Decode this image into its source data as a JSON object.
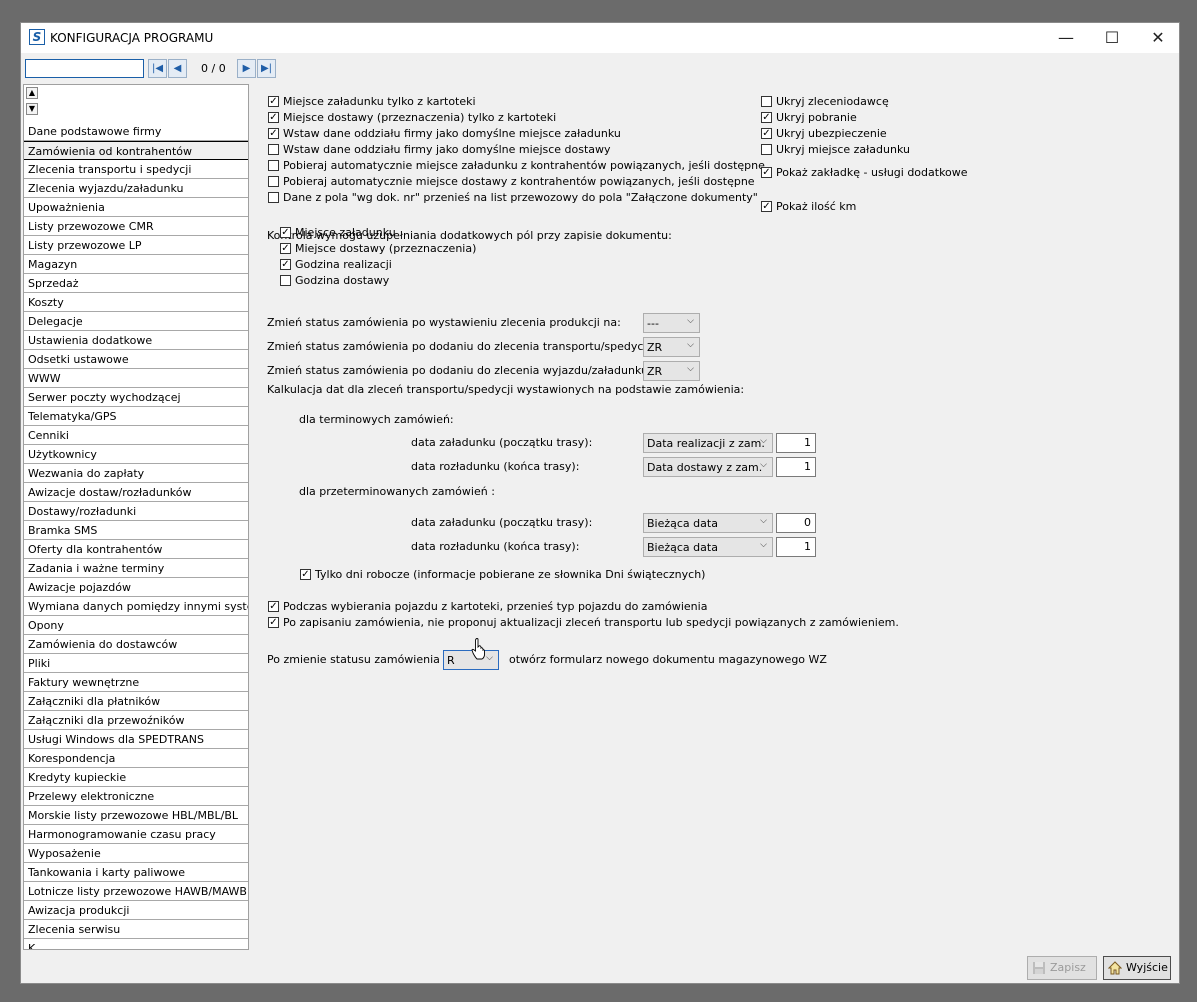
{
  "window": {
    "title": "KONFIGURACJA PROGRAMU",
    "app_icon_letter": "S",
    "minimize_glyph": "—",
    "maximize_glyph": "☐",
    "close_glyph": "✕"
  },
  "toolbar": {
    "search_value": "",
    "counter": "0 / 0",
    "first_glyph": "|◀",
    "prev_glyph": "◀",
    "next_glyph": "▶",
    "last_glyph": "▶|"
  },
  "sidebar": {
    "scroll_up_glyph": "▲",
    "scroll_down_glyph": "▼",
    "items": [
      {
        "label": "Dane podstawowe firmy"
      },
      {
        "label": "Zamówienia od kontrahentów"
      },
      {
        "label": "Zlecenia transportu i spedycji"
      },
      {
        "label": "Zlecenia wyjazdu/załadunku"
      },
      {
        "label": "Upoważnienia"
      },
      {
        "label": "Listy przewozowe CMR"
      },
      {
        "label": "Listy przewozowe LP"
      },
      {
        "label": "Magazyn"
      },
      {
        "label": "Sprzedaż"
      },
      {
        "label": "Koszty"
      },
      {
        "label": "Delegacje"
      },
      {
        "label": "Ustawienia dodatkowe"
      },
      {
        "label": "Odsetki ustawowe"
      },
      {
        "label": "WWW"
      },
      {
        "label": "Serwer poczty wychodzącej"
      },
      {
        "label": "Telematyka/GPS"
      },
      {
        "label": "Cenniki"
      },
      {
        "label": "Użytkownicy"
      },
      {
        "label": "Wezwania do zapłaty"
      },
      {
        "label": "Awizacje dostaw/rozładunków"
      },
      {
        "label": "Dostawy/rozładunki"
      },
      {
        "label": "Bramka SMS"
      },
      {
        "label": "Oferty dla kontrahentów"
      },
      {
        "label": "Zadania i ważne terminy"
      },
      {
        "label": "Awizacje pojazdów"
      },
      {
        "label": "Wymiana danych pomiędzy innymi systemami"
      },
      {
        "label": "Opony"
      },
      {
        "label": "Zamówienia do dostawców"
      },
      {
        "label": "Pliki"
      },
      {
        "label": "Faktury wewnętrzne"
      },
      {
        "label": "Załączniki dla płatników"
      },
      {
        "label": "Załączniki dla przewoźników"
      },
      {
        "label": "Usługi Windows dla SPEDTRANS"
      },
      {
        "label": "Korespondencja"
      },
      {
        "label": "Kredyty kupieckie"
      },
      {
        "label": "Przelewy elektroniczne"
      },
      {
        "label": "Morskie listy przewozowe HBL/MBL/BL"
      },
      {
        "label": "Harmonogramowanie czasu pracy"
      },
      {
        "label": "Wyposażenie"
      },
      {
        "label": "Tankowania i karty paliwowe"
      },
      {
        "label": "Lotnicze listy przewozowe HAWB/MAWB"
      },
      {
        "label": "Awizacja produkcji"
      },
      {
        "label": "Zlecenia serwisu"
      },
      {
        "label": "K"
      }
    ]
  },
  "options_left": [
    {
      "label": "Miejsce załadunku tylko z kartoteki",
      "checked": true
    },
    {
      "label": "Miejsce dostawy (przeznaczenia) tylko z kartoteki",
      "checked": true
    },
    {
      "label": "Wstaw dane oddziału firmy jako domyślne miejsce załadunku",
      "checked": true
    },
    {
      "label": "Wstaw dane oddziału firmy jako domyślne miejsce dostawy",
      "checked": false
    },
    {
      "label": "Pobieraj automatycznie miejsce załadunku z kontrahentów powiązanych, jeśli dostępne",
      "checked": false
    },
    {
      "label": "Pobieraj automatycznie miejsce dostawy  z kontrahentów powiązanych, jeśli dostępne",
      "checked": false
    },
    {
      "label": "Dane z pola \"wg dok. nr\" przenieś na list przewozowy do pola \"Załączone dokumenty\"",
      "checked": false
    }
  ],
  "options_right": [
    {
      "label": "Ukryj zleceniodawcę",
      "checked": false
    },
    {
      "label": "Ukryj pobranie",
      "checked": true
    },
    {
      "label": "Ukryj ubezpieczenie",
      "checked": true
    },
    {
      "label": "Ukryj miejsce załadunku",
      "checked": false
    },
    {
      "label": "Pokaż zakładkę - usługi dodatkowe",
      "checked": true
    },
    {
      "label": "Pokaż ilość km",
      "checked": true
    }
  ],
  "required_fields": {
    "heading": "Kontrola wymogu uzupełniania dodatkowych pól przy zapisie dokumentu:",
    "items": [
      {
        "label": "Miejsce załadunku",
        "checked": true
      },
      {
        "label": "Miejsce dostawy (przeznaczenia)",
        "checked": true
      },
      {
        "label": "Godzina realizacji",
        "checked": true
      },
      {
        "label": "Godzina dostawy",
        "checked": false
      }
    ]
  },
  "status_changes": [
    {
      "label": "Zmień status zamówienia po wystawieniu zlecenia produkcji na:",
      "value": "---"
    },
    {
      "label": "Zmień status zamówienia po dodaniu do zlecenia transportu/spedycji na:",
      "value": "ZR"
    },
    {
      "label": "Zmień status zamówienia po dodaniu do zlecenia wyjazdu/załadunku na:",
      "value": "ZR"
    }
  ],
  "date_calc": {
    "heading": "Kalkulacja dat dla zleceń transportu/spedycji wystawionych na podstawie zamówienia:",
    "timely_heading": "dla terminowych zamówień:",
    "overdue_heading": "dla przeterminowanych zamówień :",
    "timely": [
      {
        "label": "data załadunku (początku trasy):",
        "source": "Data realizacji z zam.",
        "days": "1"
      },
      {
        "label": "data rozładunku (końca trasy):",
        "source": "Data dostawy z zam.",
        "days": "1"
      }
    ],
    "overdue": [
      {
        "label": "data załadunku (początku trasy):",
        "source": "Bieżąca data",
        "days": "0"
      },
      {
        "label": "data rozładunku (końca trasy):",
        "source": "Bieżąca data",
        "days": "1"
      }
    ],
    "workdays_label": "Tylko dni robocze (informacje pobierane ze słownika Dni świątecznych)",
    "workdays_checked": true
  },
  "vehicle_options": [
    {
      "label": "Podczas wybierania pojazdu z kartoteki, przenieś typ pojazdu do zamówienia",
      "checked": true
    },
    {
      "label": "Po zapisaniu zamówienia, nie proponuj aktualizacji zleceń transportu lub spedycji powiązanych z zamówieniem.",
      "checked": true
    }
  ],
  "wz": {
    "prefix": "Po zmienie statusu zamówienia na:",
    "value": "R",
    "suffix": "otwórz formularz nowego dokumentu magazynowego WZ"
  },
  "footer": {
    "save_label": "Zapisz",
    "exit_label": "Wyjście"
  },
  "glyphs": {
    "check": "✓",
    "dropdown": "⌵"
  }
}
